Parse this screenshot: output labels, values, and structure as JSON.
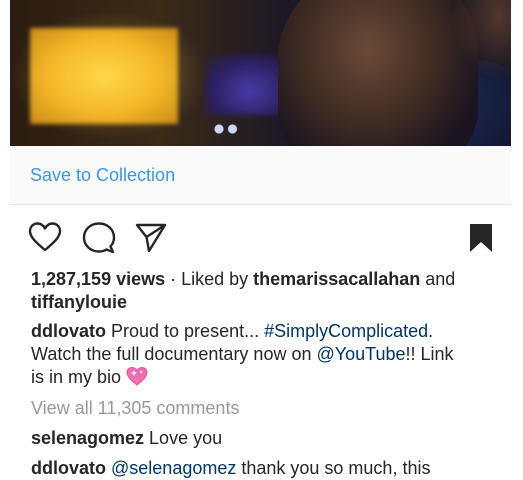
{
  "post": {
    "media": {
      "kind": "video"
    },
    "save_to_collection": "Save to Collection",
    "actions": {
      "like_icon": "heart-icon",
      "comment_icon": "comment-bubble-icon",
      "share_icon": "paper-plane-icon",
      "save_icon": "bookmark-filled-icon"
    },
    "stats": {
      "views": "1,287,159 views",
      "separator": " · Liked by ",
      "liked_by_1": "themarissacallahan",
      "and": " and",
      "liked_by_2": "tiffanylouie"
    },
    "caption": {
      "username": "ddlovato",
      "text_1": " Proud to present... ",
      "hashtag": "#SimplyComplicated",
      "text_2": ".",
      "text_3": "Watch the full documentary now on ",
      "mention": "@YouTube",
      "text_4": "!! Link",
      "text_5": "is in my bio ",
      "emoji": "sparkling-heart-emoji"
    },
    "view_all_comments": "View all 11,305 comments",
    "comments": [
      {
        "username": "selenagomez",
        "text": " Love you"
      },
      {
        "username": "ddlovato",
        "mention": "@selenagomez",
        "text": " thank you so much, this"
      }
    ]
  },
  "colors": {
    "link_blue": "#3897f0",
    "hashtag_blue": "#003569",
    "muted_gray": "#999999",
    "text": "#262626"
  }
}
